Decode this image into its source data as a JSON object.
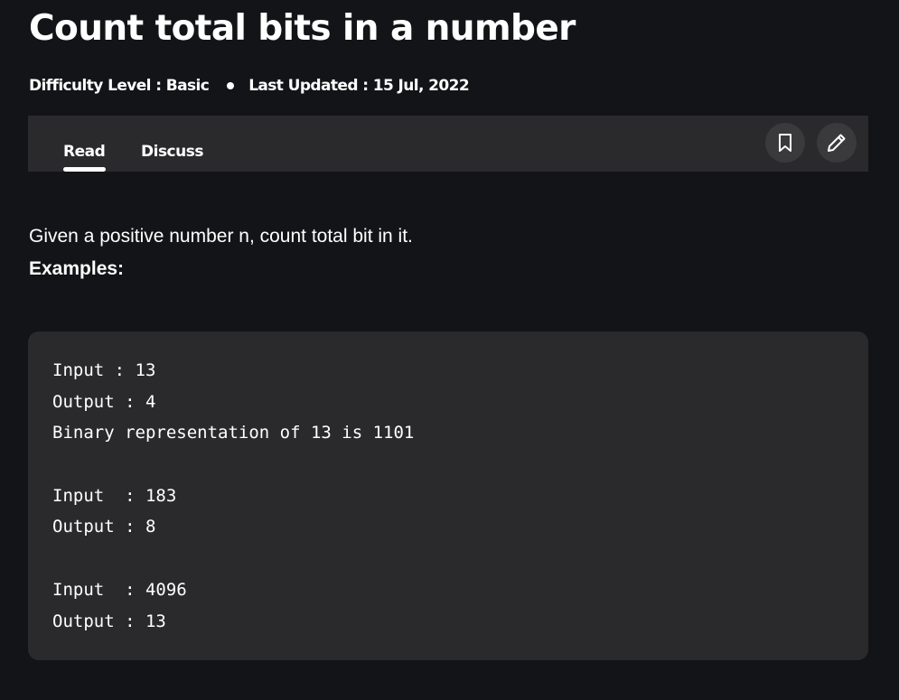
{
  "article": {
    "title": "Count total bits in a number",
    "difficulty": "Difficulty Level : Basic",
    "last_updated": "Last Updated : 15 Jul, 2022"
  },
  "tabs": [
    {
      "label": "Read",
      "active": true
    },
    {
      "label": "Discuss",
      "active": false
    }
  ],
  "actions": {
    "bookmark_icon": "bookmark-icon",
    "edit_icon": "pencil-icon"
  },
  "content": {
    "intro": "Given a positive number n, count total bit in it.",
    "examples_heading": "Examples:",
    "code_lines": [
      "Input : 13",
      "Output : 4",
      "Binary representation of 13 is 1101",
      "",
      "Input  : 183",
      "Output : 8",
      "",
      "Input  : 4096",
      "Output : 13"
    ]
  },
  "colors": {
    "background": "#131417",
    "panel": "#2a2a2c",
    "text": "#ffffff"
  }
}
